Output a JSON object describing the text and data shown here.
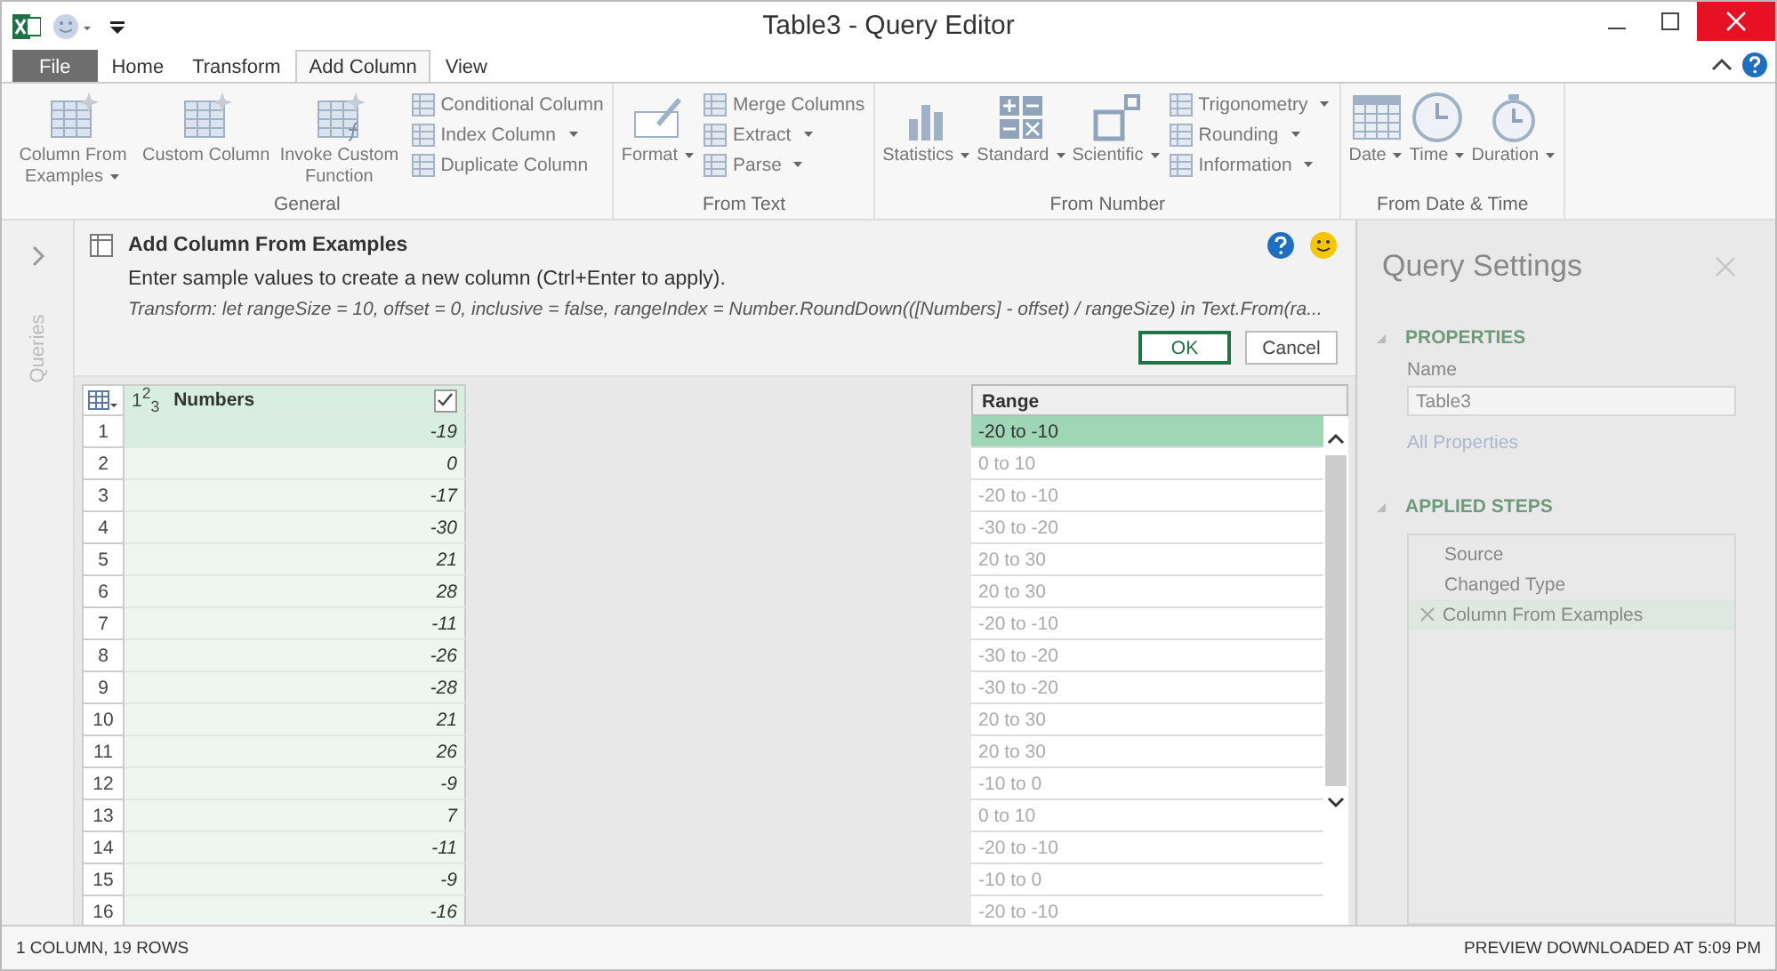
{
  "window": {
    "title": "Table3 - Query Editor"
  },
  "tabs": [
    {
      "label": "File",
      "kind": "file",
      "selected": false
    },
    {
      "label": "Home",
      "kind": "tab",
      "selected": false
    },
    {
      "label": "Transform",
      "kind": "tab",
      "selected": false
    },
    {
      "label": "Add Column",
      "kind": "tab",
      "selected": true
    },
    {
      "label": "View",
      "kind": "tab",
      "selected": false
    }
  ],
  "ribbon": [
    {
      "label": "General",
      "large": [
        {
          "label": "Column From Examples",
          "dropdown": true
        },
        {
          "label": "Custom Column",
          "dropdown": false
        },
        {
          "label": "Invoke Custom Function",
          "dropdown": false
        }
      ],
      "small": [
        {
          "label": "Conditional Column",
          "dropdown": false
        },
        {
          "label": "Index Column",
          "dropdown": true
        },
        {
          "label": "Duplicate Column",
          "dropdown": false
        }
      ]
    },
    {
      "label": "From Text",
      "large": [
        {
          "label": "Format",
          "dropdown": true
        }
      ],
      "small": [
        {
          "label": "Merge Columns",
          "dropdown": false
        },
        {
          "label": "Extract",
          "dropdown": true
        },
        {
          "label": "Parse",
          "dropdown": true
        }
      ]
    },
    {
      "label": "From Number",
      "large": [
        {
          "label": "Statistics",
          "dropdown": true
        },
        {
          "label": "Standard",
          "dropdown": true
        },
        {
          "label": "Scientific",
          "dropdown": true
        }
      ],
      "small": [
        {
          "label": "Trigonometry",
          "dropdown": true
        },
        {
          "label": "Rounding",
          "dropdown": true
        },
        {
          "label": "Information",
          "dropdown": true
        }
      ]
    },
    {
      "label": "From Date & Time",
      "large": [
        {
          "label": "Date",
          "dropdown": true
        },
        {
          "label": "Time",
          "dropdown": true
        },
        {
          "label": "Duration",
          "dropdown": true
        }
      ]
    }
  ],
  "queries_pane": {
    "label": "Queries"
  },
  "examples_panel": {
    "title": "Add Column From Examples",
    "description": "Enter sample values to create a new column (Ctrl+Enter to apply).",
    "transform": "Transform: let rangeSize = 10, offset = 0, inclusive = false, rangeIndex = Number.RoundDown(([Numbers] - offset) / rangeSize) in Text.From(ra...",
    "buttons": [
      "OK",
      "Cancel"
    ]
  },
  "table": {
    "column": {
      "type": "1$^{2}$$_{3}$",
      "name": "Numbers",
      "checked": true
    },
    "new_column": {
      "name": "Range"
    },
    "rows": [
      {
        "index": "1",
        "number": "-19",
        "range": "-20 to -10",
        "entered": true
      },
      {
        "index": "2",
        "number": "0",
        "range": "0 to 10",
        "entered": false
      },
      {
        "index": "3",
        "number": "-17",
        "range": "-20 to -10",
        "entered": false
      },
      {
        "index": "4",
        "number": "-30",
        "range": "-30 to -20",
        "entered": false
      },
      {
        "index": "5",
        "number": "21",
        "range": "20 to 30",
        "entered": false
      },
      {
        "index": "6",
        "number": "28",
        "range": "20 to 30",
        "entered": false
      },
      {
        "index": "7",
        "number": "-11",
        "range": "-20 to -10",
        "entered": false
      },
      {
        "index": "8",
        "number": "-26",
        "range": "-30 to -20",
        "entered": false
      },
      {
        "index": "9",
        "number": "-28",
        "range": "-30 to -20",
        "entered": false
      },
      {
        "index": "10",
        "number": "21",
        "range": "20 to 30",
        "entered": false
      },
      {
        "index": "11",
        "number": "26",
        "range": "20 to 30",
        "entered": false
      },
      {
        "index": "12",
        "number": "-9",
        "range": "-10 to 0",
        "entered": false
      },
      {
        "index": "13",
        "number": "7",
        "range": "0 to 10",
        "entered": false
      },
      {
        "index": "14",
        "number": "-11",
        "range": "-20 to -10",
        "entered": false
      },
      {
        "index": "15",
        "number": "-9",
        "range": "-10 to 0",
        "entered": false
      },
      {
        "index": "16",
        "number": "-16",
        "range": "-20 to -10",
        "entered": false
      }
    ]
  },
  "query_settings": {
    "title": "Query Settings",
    "properties_heading": "PROPERTIES",
    "name_label": "Name",
    "name_value": "Table3",
    "all_properties": "All Properties",
    "steps_heading": "APPLIED STEPS",
    "steps": [
      {
        "label": "Source",
        "selected": false
      },
      {
        "label": "Changed Type",
        "selected": false
      },
      {
        "label": "Column From Examples",
        "selected": true
      }
    ]
  },
  "status_bar": {
    "left": "1 COLUMN, 19 ROWS",
    "right": "PREVIEW DOWNLOADED AT 5:09 PM"
  }
}
